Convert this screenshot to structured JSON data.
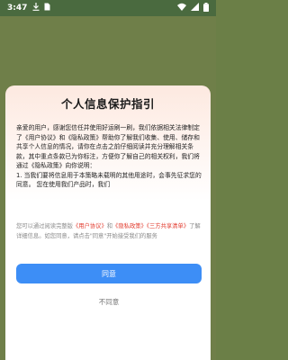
{
  "status_bar": {
    "time": "3:47",
    "icons": [
      "download-icon",
      "sim-icon",
      "wifi-icon",
      "signal-icon",
      "battery-icon"
    ]
  },
  "dialog": {
    "title": "个人信息保护指引",
    "paragraphs": [
      "亲爱的用户，感谢您信任并使用好运刷一刷，我们依据相关法律制定了《用户协议》和《隐私政策》帮助你了解我们收集、使用、储存和共享个人信息的情况，请你在点击之前仔细阅读并充分理解相关条款，其中重点条款已为你标注，方便你了解自己的相关权利，我们将通过《隐私政策》向你说明：",
      "1. 当我们要将信息用于本策略未载明的其他用途时，会事先征求您的同意。 您在使用我们产品时，我们"
    ],
    "notice": {
      "prefix": "您可以通过阅读完整版",
      "link_user_agreement": "《用户协议》",
      "and": "和",
      "link_privacy_policy": "《隐私政策》",
      "link_third_party": "《三方共享清单》",
      "suffix": "了解详细信息。如您同意，请点击\"同意\"开始接受我们的服务"
    },
    "agree_label": "同意",
    "disagree_label": "不同意"
  },
  "colors": {
    "status_bar": "#4a6a3f",
    "background": "#6f7f49",
    "accent": "#3d8ef6",
    "link": "#e23b2e"
  }
}
